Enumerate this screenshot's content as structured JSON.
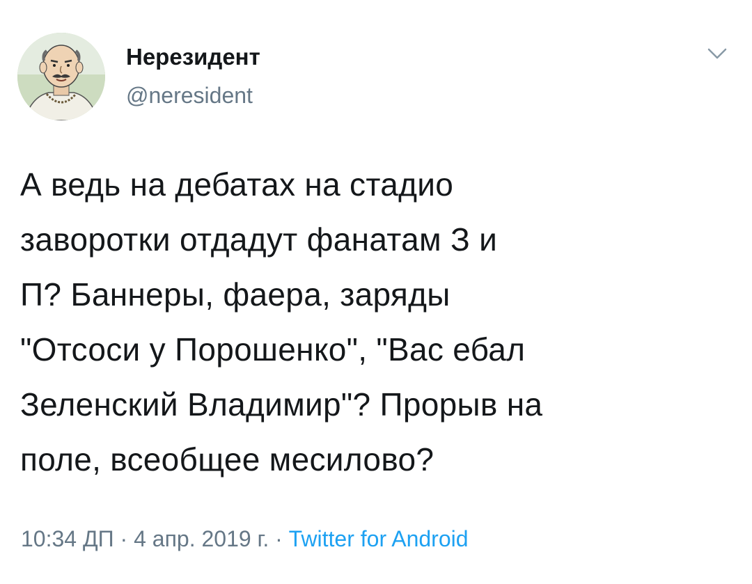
{
  "author": {
    "display_name": "Нерезидент",
    "handle": "@neresident"
  },
  "tweet": {
    "text": "А ведь на дебатах на стадио\nзаворотки отдадут фанатам З и\nП? Баннеры, фаера, заряды\n\"Отсоси у Порошенко\", \"Вас ебал\nЗеленский Владимир\"? Прорыв на\nполе, всеобщее месилово?",
    "time": "10:34 ДП",
    "separator": "·",
    "date": "4 апр. 2019 г.",
    "source": "Twitter for Android"
  },
  "icons": {
    "menu": "chevron-down-icon",
    "avatar": "avatar-cartoon-man"
  },
  "colors": {
    "text": "#14171a",
    "secondary": "#657786",
    "link": "#1da1f2",
    "background": "#ffffff"
  }
}
